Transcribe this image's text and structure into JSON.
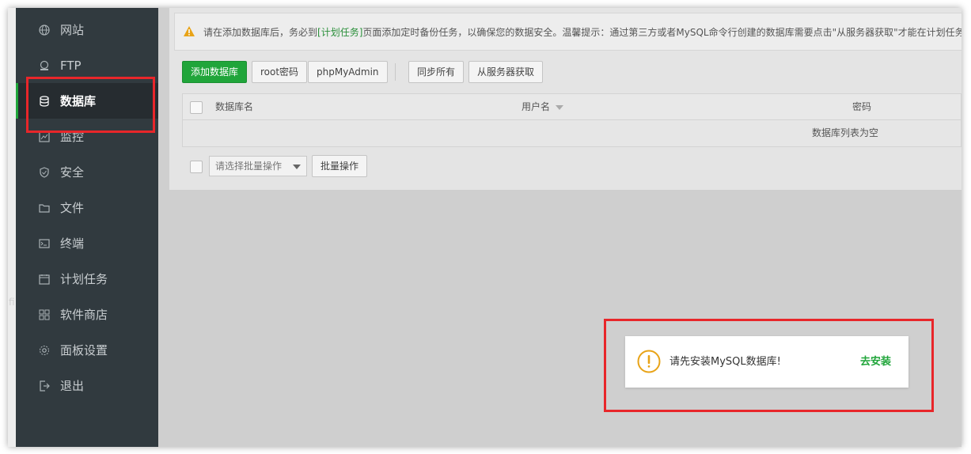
{
  "sidebar": {
    "items": [
      {
        "label": "网站",
        "icon": "globe-icon"
      },
      {
        "label": "FTP",
        "icon": "ftp-icon"
      },
      {
        "label": "数据库",
        "icon": "database-icon",
        "active": true
      },
      {
        "label": "监控",
        "icon": "monitor-icon"
      },
      {
        "label": "安全",
        "icon": "shield-icon"
      },
      {
        "label": "文件",
        "icon": "folder-icon"
      },
      {
        "label": "终端",
        "icon": "terminal-icon"
      },
      {
        "label": "计划任务",
        "icon": "calendar-icon"
      },
      {
        "label": "软件商店",
        "icon": "grid-icon"
      },
      {
        "label": "面板设置",
        "icon": "gear-icon"
      },
      {
        "label": "退出",
        "icon": "logout-icon"
      }
    ]
  },
  "notice": {
    "before": "请在添加数据库后，务必到",
    "link": "[计划任务]",
    "after": "页面添加定时备份任务，以确保您的数据安全。温馨提示：通过第三方或者MySQL命令行创建的数据库需要点击\"从服务器获取\"才能在计划任务"
  },
  "toolbar": {
    "add_db": "添加数据库",
    "root_password": "root密码",
    "phpmyadmin": "phpMyAdmin",
    "sync_all": "同步所有",
    "fetch_from_server": "从服务器获取"
  },
  "table": {
    "columns": [
      "数据库名",
      "用户名",
      "密码"
    ],
    "empty_text": "数据库列表为空"
  },
  "batch": {
    "select_placeholder": "请选择批量操作",
    "button": "批量操作"
  },
  "toast": {
    "message": "请先安装MySQL数据库!",
    "action": "去安装"
  },
  "colors": {
    "sidebar_bg": "#313a3f",
    "accent_green": "#20a53a",
    "highlight_red": "#e8262a",
    "warning_orange": "#e8a317"
  }
}
